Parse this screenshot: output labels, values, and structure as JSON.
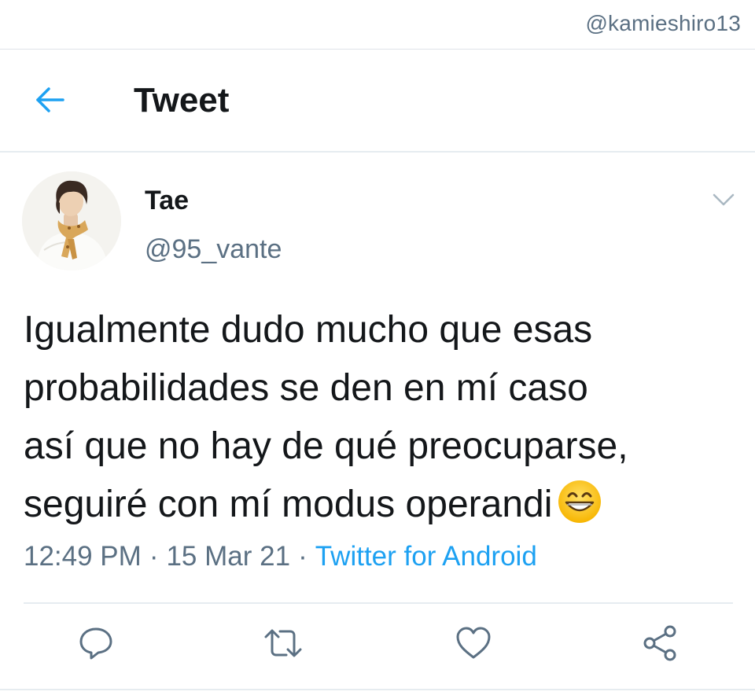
{
  "watermark": "@kamieshiro13",
  "header": {
    "title": "Tweet",
    "back_icon": "arrow-left-icon"
  },
  "author": {
    "display_name": "Tae",
    "handle": "@95_vante",
    "avatar": "profile-photo",
    "menu_icon": "chevron-down-icon"
  },
  "tweet": {
    "lines": [
      "Igualmente dudo mucho que esas",
      "probabilidades se den en mí caso",
      "así que no hay de qué preocuparse,",
      "seguiré con mí modus operandi"
    ],
    "emoji": "grinning-face-with-smiling-eyes"
  },
  "meta": {
    "time": "12:49 PM",
    "separator": "·",
    "date": "15 Mar 21",
    "source": "Twitter for Android"
  },
  "actions": [
    "reply-icon",
    "retweet-icon",
    "like-icon",
    "share-icon"
  ],
  "colors": {
    "accent": "#1da1f2",
    "secondary_text": "#5b7083",
    "primary_text": "#14171a",
    "divider": "#e6ecf0"
  }
}
